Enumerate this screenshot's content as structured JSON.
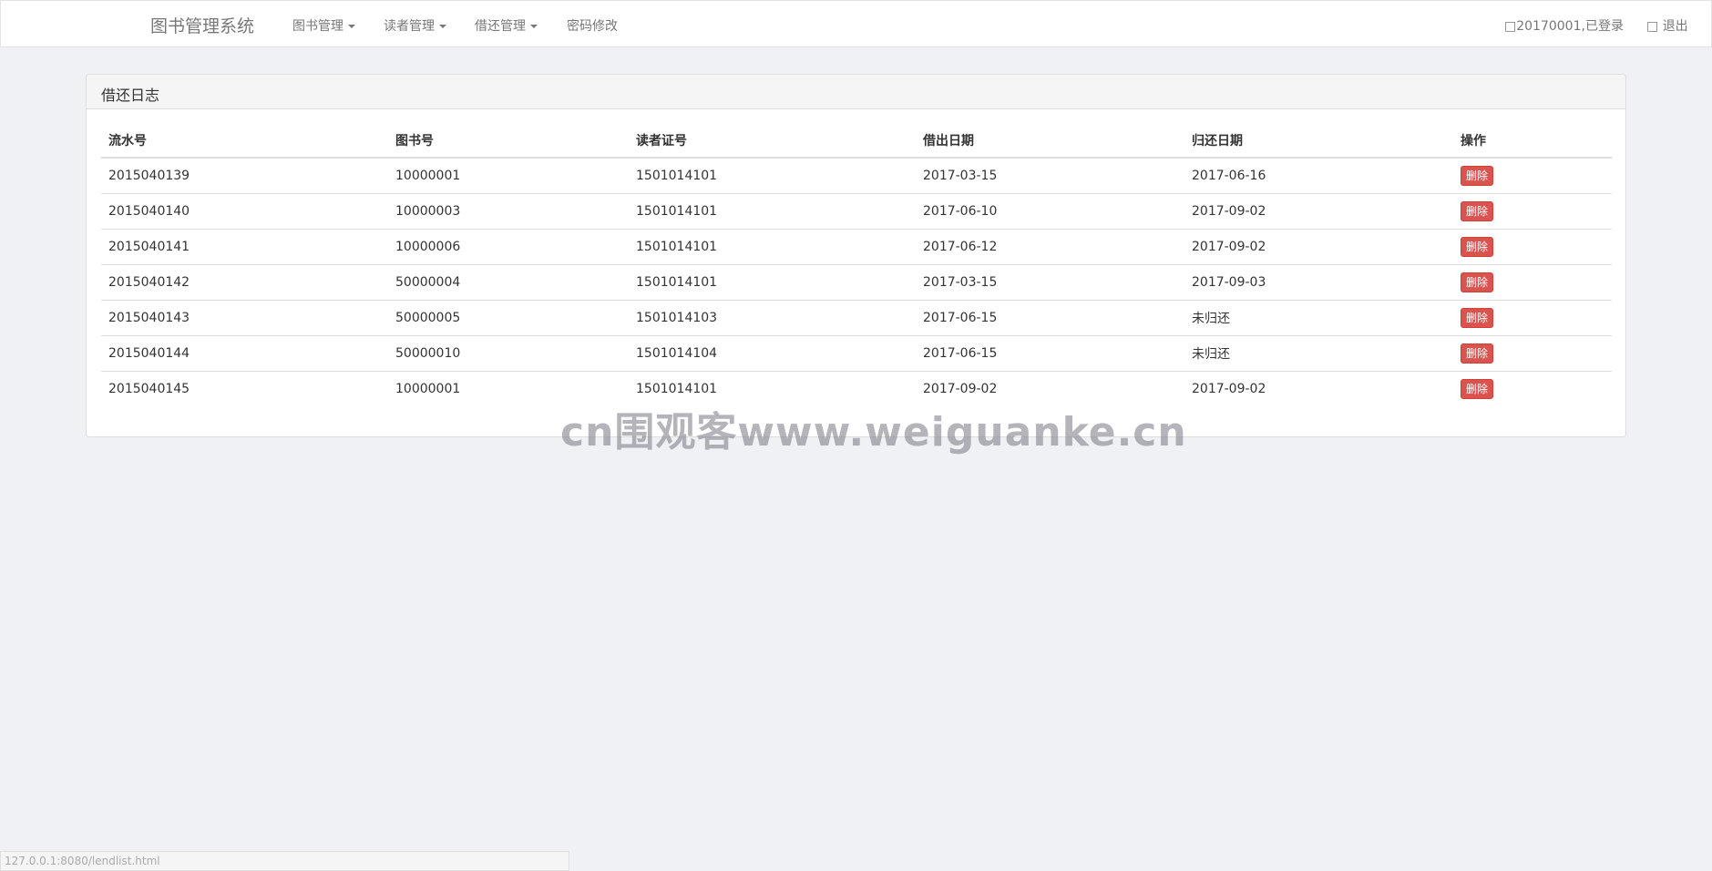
{
  "navbar": {
    "brand": "图书管理系统",
    "menu": [
      {
        "label": "图书管理"
      },
      {
        "label": "读者管理"
      },
      {
        "label": "借还管理"
      },
      {
        "label": "密码修改"
      }
    ],
    "user_status": "20170001,已登录",
    "logout": "退出"
  },
  "panel": {
    "title": "借还日志",
    "columns": [
      "流水号",
      "图书号",
      "读者证号",
      "借出日期",
      "归还日期",
      "操作"
    ],
    "rows": [
      {
        "serial": "2015040139",
        "book_id": "10000001",
        "reader_id": "1501014101",
        "lend_date": "2017-03-15",
        "return_date": "2017-06-16",
        "action": "删除"
      },
      {
        "serial": "2015040140",
        "book_id": "10000003",
        "reader_id": "1501014101",
        "lend_date": "2017-06-10",
        "return_date": "2017-09-02",
        "action": "删除"
      },
      {
        "serial": "2015040141",
        "book_id": "10000006",
        "reader_id": "1501014101",
        "lend_date": "2017-06-12",
        "return_date": "2017-09-02",
        "action": "删除"
      },
      {
        "serial": "2015040142",
        "book_id": "50000004",
        "reader_id": "1501014101",
        "lend_date": "2017-03-15",
        "return_date": "2017-09-03",
        "action": "删除"
      },
      {
        "serial": "2015040143",
        "book_id": "50000005",
        "reader_id": "1501014103",
        "lend_date": "2017-06-15",
        "return_date": "未归还",
        "action": "删除"
      },
      {
        "serial": "2015040144",
        "book_id": "50000010",
        "reader_id": "1501014104",
        "lend_date": "2017-06-15",
        "return_date": "未归还",
        "action": "删除"
      },
      {
        "serial": "2015040145",
        "book_id": "10000001",
        "reader_id": "1501014101",
        "lend_date": "2017-09-02",
        "return_date": "2017-09-02",
        "action": "删除"
      }
    ]
  },
  "watermark": "cn围观客www.weiguanke.cn",
  "statusbar": "127.0.0.1:8080/lendlist.html",
  "colors": {
    "danger": "#d9534f",
    "background": "#f0f1f4"
  }
}
